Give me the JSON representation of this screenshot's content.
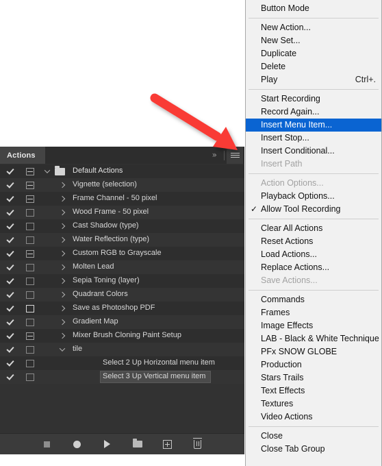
{
  "panel": {
    "tab_label": "Actions",
    "collapse_label": "»",
    "hamburger_name": "panel-menu-icon",
    "footer_buttons": [
      {
        "name": "stop-button",
        "label": "Stop"
      },
      {
        "name": "record-button",
        "label": "Begin recording"
      },
      {
        "name": "play-button",
        "label": "Play selection"
      },
      {
        "name": "new-set-button",
        "label": "Create new set"
      },
      {
        "name": "new-action-button",
        "label": "Create new action"
      },
      {
        "name": "delete-button",
        "label": "Delete"
      }
    ],
    "rows": [
      {
        "label": "Default Actions",
        "type": "set",
        "checked": true,
        "dialog": "filled",
        "expanded": true,
        "indent": 0
      },
      {
        "label": "Vignette (selection)",
        "type": "action",
        "checked": true,
        "dialog": "filled",
        "expanded": false,
        "indent": 1
      },
      {
        "label": "Frame Channel - 50 pixel",
        "type": "action",
        "checked": true,
        "dialog": "filled",
        "expanded": false,
        "indent": 1
      },
      {
        "label": "Wood Frame - 50 pixel",
        "type": "action",
        "checked": true,
        "dialog": "hollow",
        "expanded": false,
        "indent": 1
      },
      {
        "label": "Cast Shadow (type)",
        "type": "action",
        "checked": true,
        "dialog": "hollow",
        "expanded": false,
        "indent": 1
      },
      {
        "label": "Water Reflection (type)",
        "type": "action",
        "checked": true,
        "dialog": "hollow",
        "expanded": false,
        "indent": 1
      },
      {
        "label": "Custom RGB to Grayscale",
        "type": "action",
        "checked": true,
        "dialog": "filled",
        "expanded": false,
        "indent": 1
      },
      {
        "label": "Molten Lead",
        "type": "action",
        "checked": true,
        "dialog": "hollow",
        "expanded": false,
        "indent": 1
      },
      {
        "label": "Sepia Toning (layer)",
        "type": "action",
        "checked": true,
        "dialog": "hollow",
        "expanded": false,
        "indent": 1
      },
      {
        "label": "Quadrant Colors",
        "type": "action",
        "checked": true,
        "dialog": "hollow",
        "expanded": false,
        "indent": 1
      },
      {
        "label": "Save as Photoshop PDF",
        "type": "action",
        "checked": true,
        "dialog": "white",
        "expanded": false,
        "indent": 1
      },
      {
        "label": "Gradient Map",
        "type": "action",
        "checked": true,
        "dialog": "hollow",
        "expanded": false,
        "indent": 1
      },
      {
        "label": "Mixer Brush Cloning Paint Setup",
        "type": "action",
        "checked": true,
        "dialog": "filled",
        "expanded": false,
        "indent": 1
      },
      {
        "label": "tile",
        "type": "action",
        "checked": true,
        "dialog": "hollow",
        "expanded": true,
        "indent": 1
      },
      {
        "label": "Select 2 Up Horizontal menu item",
        "type": "step",
        "checked": true,
        "dialog": "hollow",
        "expanded": null,
        "indent": 2
      },
      {
        "label": "Select 3 Up Vertical menu item",
        "type": "step",
        "checked": true,
        "dialog": "hollow",
        "expanded": null,
        "indent": 2,
        "selected": true
      }
    ]
  },
  "context_menu": {
    "highlight_color": "#0a64d2",
    "groups": [
      [
        {
          "label": "Button Mode",
          "state": "normal",
          "accel": "",
          "checked": false
        }
      ],
      [
        {
          "label": "New Action...",
          "state": "normal",
          "accel": "",
          "checked": false
        },
        {
          "label": "New Set...",
          "state": "normal",
          "accel": "",
          "checked": false
        },
        {
          "label": "Duplicate",
          "state": "normal",
          "accel": "",
          "checked": false
        },
        {
          "label": "Delete",
          "state": "normal",
          "accel": "",
          "checked": false
        },
        {
          "label": "Play",
          "state": "normal",
          "accel": "Ctrl+.",
          "checked": false
        }
      ],
      [
        {
          "label": "Start Recording",
          "state": "normal",
          "accel": "",
          "checked": false
        },
        {
          "label": "Record Again...",
          "state": "normal",
          "accel": "",
          "checked": false
        },
        {
          "label": "Insert Menu Item...",
          "state": "highlighted",
          "accel": "",
          "checked": false
        },
        {
          "label": "Insert Stop...",
          "state": "normal",
          "accel": "",
          "checked": false
        },
        {
          "label": "Insert Conditional...",
          "state": "normal",
          "accel": "",
          "checked": false
        },
        {
          "label": "Insert Path",
          "state": "disabled",
          "accel": "",
          "checked": false
        }
      ],
      [
        {
          "label": "Action Options...",
          "state": "disabled",
          "accel": "",
          "checked": false
        },
        {
          "label": "Playback Options...",
          "state": "normal",
          "accel": "",
          "checked": false
        },
        {
          "label": "Allow Tool Recording",
          "state": "normal",
          "accel": "",
          "checked": true
        }
      ],
      [
        {
          "label": "Clear All Actions",
          "state": "normal",
          "accel": "",
          "checked": false
        },
        {
          "label": "Reset Actions",
          "state": "normal",
          "accel": "",
          "checked": false
        },
        {
          "label": "Load Actions...",
          "state": "normal",
          "accel": "",
          "checked": false
        },
        {
          "label": "Replace Actions...",
          "state": "normal",
          "accel": "",
          "checked": false
        },
        {
          "label": "Save Actions...",
          "state": "disabled",
          "accel": "",
          "checked": false
        }
      ],
      [
        {
          "label": "Commands",
          "state": "normal",
          "accel": "",
          "checked": false
        },
        {
          "label": "Frames",
          "state": "normal",
          "accel": "",
          "checked": false
        },
        {
          "label": "Image Effects",
          "state": "normal",
          "accel": "",
          "checked": false
        },
        {
          "label": "LAB - Black & White Technique",
          "state": "normal",
          "accel": "",
          "checked": false
        },
        {
          "label": "PFx SNOW GLOBE",
          "state": "normal",
          "accel": "",
          "checked": false
        },
        {
          "label": "Production",
          "state": "normal",
          "accel": "",
          "checked": false
        },
        {
          "label": "Stars Trails",
          "state": "normal",
          "accel": "",
          "checked": false
        },
        {
          "label": "Text Effects",
          "state": "normal",
          "accel": "",
          "checked": false
        },
        {
          "label": "Textures",
          "state": "normal",
          "accel": "",
          "checked": false
        },
        {
          "label": "Video Actions",
          "state": "normal",
          "accel": "",
          "checked": false
        }
      ],
      [
        {
          "label": "Close",
          "state": "normal",
          "accel": "",
          "checked": false
        },
        {
          "label": "Close Tab Group",
          "state": "normal",
          "accel": "",
          "checked": false
        }
      ]
    ]
  },
  "annotation": {
    "arrow_color": "#f93b36",
    "points_to": "panel-menu-icon"
  }
}
